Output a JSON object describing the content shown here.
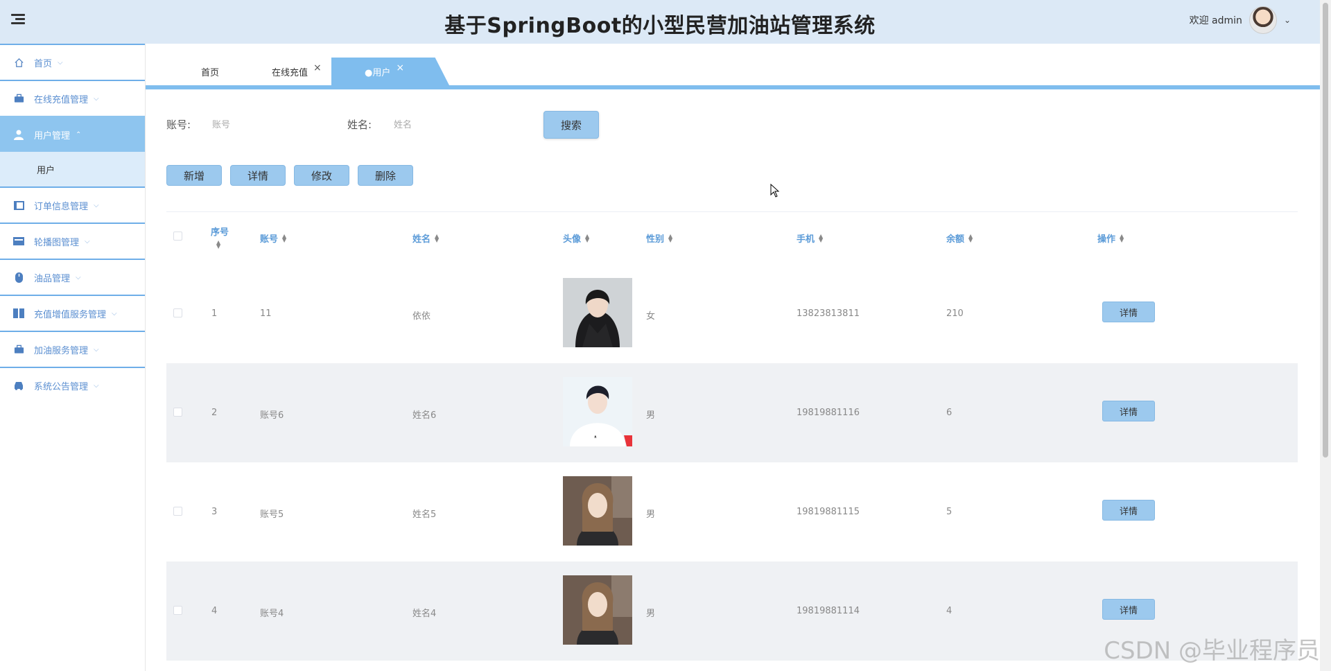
{
  "header": {
    "title": "基于SpringBoot的小型民营加油站管理系统",
    "welcome": "欢迎 admin"
  },
  "sidebar": {
    "items": [
      {
        "label": "首页",
        "icon": "home-icon"
      },
      {
        "label": "在线充值管理",
        "icon": "briefcase-icon"
      },
      {
        "label": "用户管理",
        "icon": "user-icon",
        "active": true
      },
      {
        "label": "订单信息管理",
        "icon": "book-icon"
      },
      {
        "label": "轮播图管理",
        "icon": "carousel-icon"
      },
      {
        "label": "油品管理",
        "icon": "mouse-icon"
      },
      {
        "label": "充值增值服务管理",
        "icon": "columns-icon"
      },
      {
        "label": "加油服务管理",
        "icon": "briefcase-icon"
      },
      {
        "label": "系统公告管理",
        "icon": "car-icon"
      }
    ],
    "sub_item": "用户"
  },
  "tabs": [
    {
      "label": "首页"
    },
    {
      "label": "在线充值"
    },
    {
      "label": "●用户"
    }
  ],
  "search": {
    "account_label": "账号:",
    "account_placeholder": "账号",
    "name_label": "姓名:",
    "name_placeholder": "姓名",
    "button": "搜索"
  },
  "actions": {
    "add": "新增",
    "detail": "详情",
    "edit": "修改",
    "delete": "删除"
  },
  "table": {
    "columns": [
      "序号",
      "账号",
      "姓名",
      "头像",
      "性别",
      "手机",
      "余额",
      "操作"
    ],
    "rows": [
      {
        "index": "1",
        "account": "11",
        "name": "依依",
        "gender": "女",
        "phone": "13823813811",
        "balance": "210",
        "action": "详情"
      },
      {
        "index": "2",
        "account": "账号6",
        "name": "姓名6",
        "gender": "男",
        "phone": "19819881116",
        "balance": "6",
        "action": "详情"
      },
      {
        "index": "3",
        "account": "账号5",
        "name": "姓名5",
        "gender": "男",
        "phone": "19819881115",
        "balance": "5",
        "action": "详情"
      },
      {
        "index": "4",
        "account": "账号4",
        "name": "姓名4",
        "gender": "男",
        "phone": "19819881114",
        "balance": "4",
        "action": "详情"
      }
    ]
  },
  "watermark": "CSDN @毕业程序员",
  "colors": {
    "accent": "#7fbdee",
    "header_bg": "#dce9f6",
    "button": "#9cc9ee",
    "link": "#5b9bd8"
  }
}
